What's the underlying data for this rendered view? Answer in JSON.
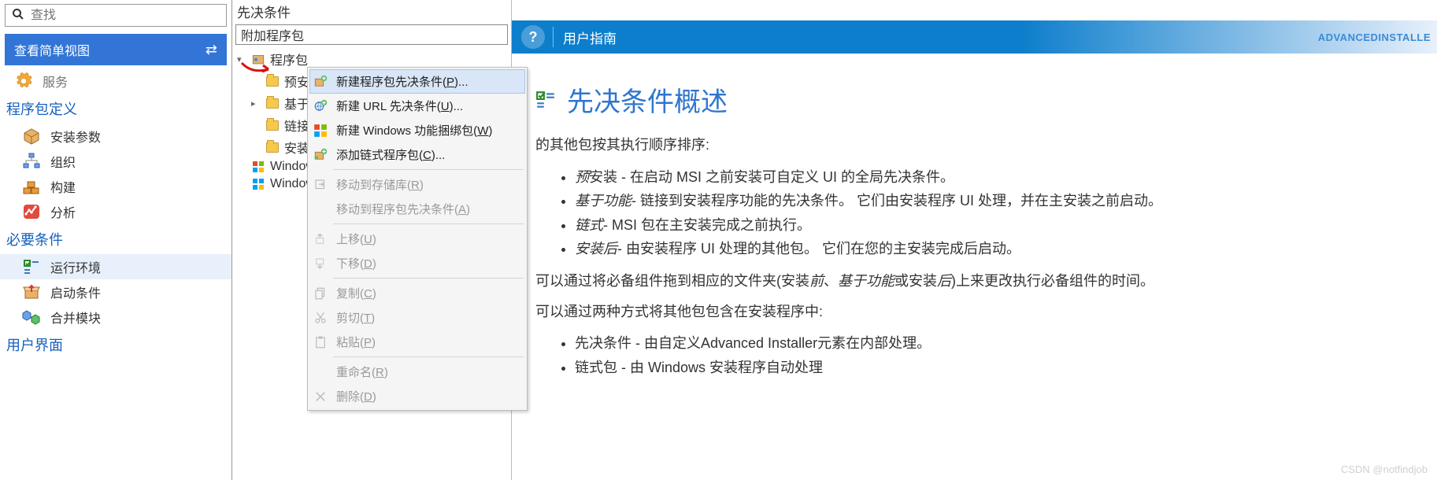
{
  "left": {
    "search_placeholder": "查找",
    "view_button": "查看简单视图",
    "top_item": "服务",
    "section1_title": "程序包定义",
    "section1_items": [
      "安装参数",
      "组织",
      "构建",
      "分析"
    ],
    "section2_title": "必要条件",
    "section2_items": [
      "运行环境",
      "启动条件",
      "合并模块"
    ],
    "section2_selected_index": 0,
    "section3_title": "用户界面"
  },
  "mid": {
    "title": "先决条件",
    "input_value": "附加程序包",
    "tree": {
      "root": "程序包",
      "items": [
        "预安装",
        "基于",
        "链接",
        "安装",
        "Window",
        "Window"
      ]
    }
  },
  "context_menu": {
    "items": [
      {
        "label_pre": "新建程序包先决条件(",
        "key": "P",
        "label_post": ")...",
        "enabled": true,
        "hover": true,
        "icon": "package-plus"
      },
      {
        "label_pre": "新建 URL 先决条件(",
        "key": "U",
        "label_post": ")...",
        "enabled": true,
        "icon": "url-plus"
      },
      {
        "label_pre": "新建 Windows 功能捆绑包(",
        "key": "W",
        "label_post": ")",
        "enabled": true,
        "icon": "windows-bundle"
      },
      {
        "label_pre": "添加链式程序包(",
        "key": "C",
        "label_post": ")...",
        "enabled": true,
        "icon": "chain-plus"
      },
      {
        "sep": true
      },
      {
        "label_pre": "移动到存储库(",
        "key": "R",
        "label_post": ")",
        "enabled": false,
        "icon": "move-repo"
      },
      {
        "label_pre": "移动到程序包先决条件(",
        "key": "A",
        "label_post": ")",
        "enabled": false,
        "icon": ""
      },
      {
        "sep": true
      },
      {
        "label_pre": "上移(",
        "key": "U",
        "label_post": ")",
        "enabled": false,
        "icon": "move-up"
      },
      {
        "label_pre": "下移(",
        "key": "D",
        "label_post": ")",
        "enabled": false,
        "icon": "move-down"
      },
      {
        "sep": true
      },
      {
        "label_pre": "复制(",
        "key": "C",
        "label_post": ")",
        "enabled": false,
        "icon": "copy"
      },
      {
        "label_pre": "剪切(",
        "key": "T",
        "label_post": ")",
        "enabled": false,
        "icon": "cut"
      },
      {
        "label_pre": "粘贴(",
        "key": "P",
        "label_post": ")",
        "enabled": false,
        "icon": "paste"
      },
      {
        "sep": true
      },
      {
        "label_pre": "重命名(",
        "key": "R",
        "label_post": ")",
        "enabled": false,
        "icon": ""
      },
      {
        "label_pre": "删除(",
        "key": "D",
        "label_post": ")",
        "enabled": false,
        "icon": "delete"
      }
    ]
  },
  "right": {
    "banner_title": "用户指南",
    "banner_right": "ADVANCEDINSTALLE",
    "heading": "先决条件概述",
    "intro_tail": "的其他包按其执行顺序排序:",
    "bullets1": [
      {
        "em": "预",
        "strong": "安装",
        "tail": " - 在启动 MSI 之前安装可自定义 UI 的全局先决条件。"
      },
      {
        "em": "基于功能",
        "tail": "- 链接到安装程序功能的先决条件。 它们由安装程序 UI 处理，并在主安装之前启动。"
      },
      {
        "em": "链式",
        "tail": "- MSI 包在主安装完成之前执行。"
      },
      {
        "em": "安装后",
        "tail": "- 由安装程序 UI 处理的其他包。 它们在您的主安装完成后启动。"
      }
    ],
    "para2_pre": "可以通过将必备组件拖到相应的文件夹(安装",
    "para2_em1": "前",
    "para2_mid1": "、",
    "para2_em2": "基于功能",
    "para2_mid2": "或安装",
    "para2_em3": "后",
    "para2_post": ")上来更改执行必备组件的时间。",
    "para3": "可以通过两种方式将其他包包含在安装程序中:",
    "bullets2": [
      "先决条件 - 由自定义Advanced Installer元素在内部处理。",
      "链式包 - 由 Windows 安装程序自动处理"
    ]
  },
  "watermark": "CSDN @notfindjob"
}
